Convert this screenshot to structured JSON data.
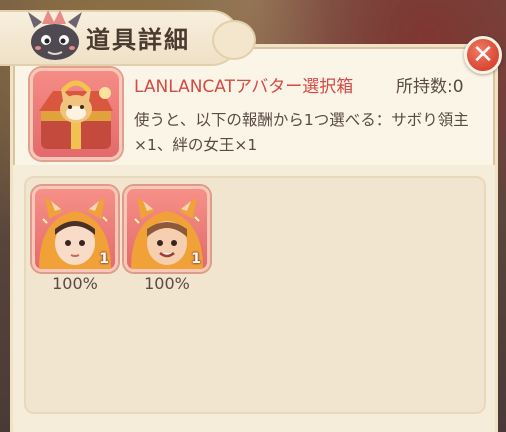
{
  "dialog": {
    "title": "道具詳細"
  },
  "item": {
    "name": "LANLANCATアバター選択箱",
    "holding_label": "所持数:",
    "holding_value": "0",
    "description": "使うと、以下の報酬から1つ選べる：サボり領主×1、絆の女王×1",
    "icon": "gift-box-cat-icon"
  },
  "rewards": [
    {
      "icon": "cat-hood-avatar-girl-icon",
      "count": "1",
      "rate": "100%"
    },
    {
      "icon": "cat-hood-avatar-woman-icon",
      "count": "1",
      "rate": "100%"
    }
  ],
  "colors": {
    "accent_red": "#d24a45",
    "panel": "#fbf5e8",
    "tile": "#e46a6c"
  }
}
